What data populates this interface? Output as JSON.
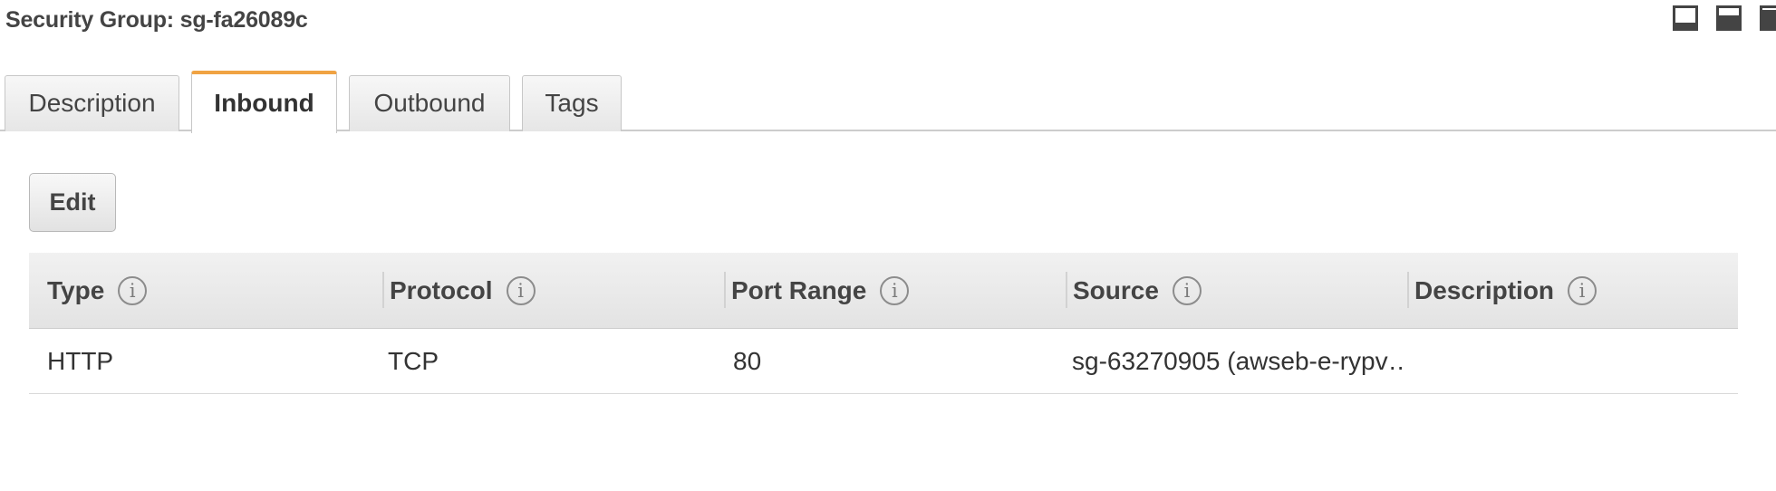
{
  "panel": {
    "title": "Security Group: sg-fa26089c"
  },
  "layout_controls": {
    "icons": [
      "panel-bottom-icon",
      "panel-split-icon",
      "panel-maximize-icon"
    ]
  },
  "tabs": [
    {
      "label": "Description",
      "active": false
    },
    {
      "label": "Inbound",
      "active": true
    },
    {
      "label": "Outbound",
      "active": false
    },
    {
      "label": "Tags",
      "active": false
    }
  ],
  "toolbar": {
    "edit_label": "Edit"
  },
  "rules_table": {
    "info_glyph": "i",
    "columns": [
      "Type",
      "Protocol",
      "Port Range",
      "Source",
      "Description"
    ],
    "rows": [
      {
        "type": "HTTP",
        "protocol": "TCP",
        "port_range": "80",
        "source": "sg-63270905 (awseb-e-rypv…",
        "description": ""
      }
    ]
  },
  "colors": {
    "active_tab_accent": "#f0a343",
    "header_bg": "#e8e8e8",
    "text": "#333333"
  }
}
